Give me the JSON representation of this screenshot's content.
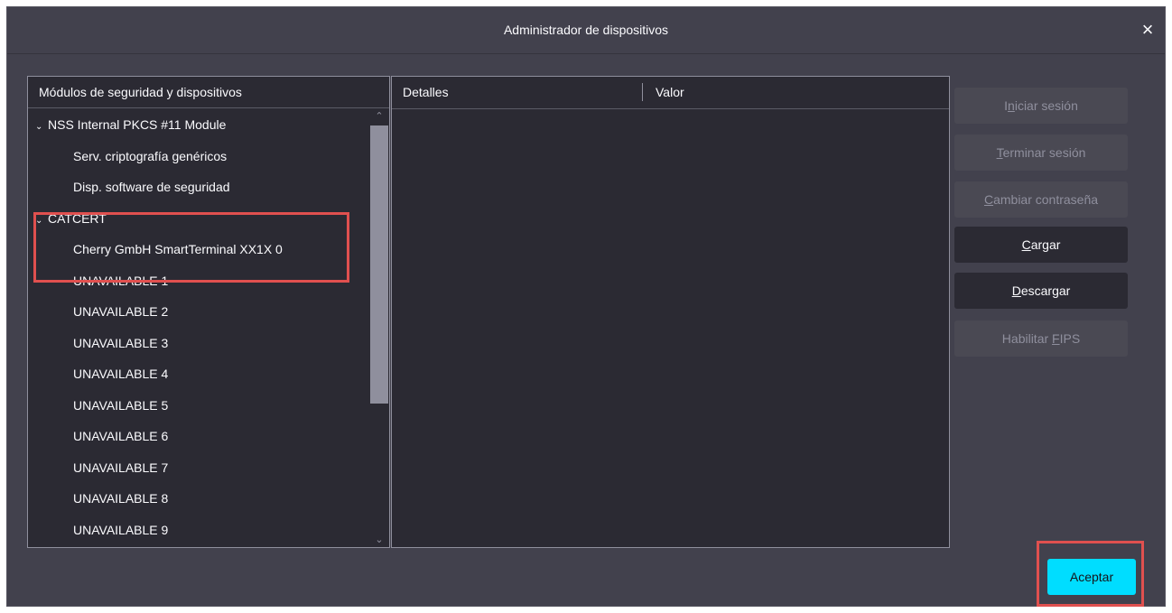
{
  "window": {
    "title": "Administrador de dispositivos",
    "close_icon": "×"
  },
  "tree": {
    "header": "Módulos de seguridad y dispositivos",
    "rows": [
      {
        "label": "NSS Internal PKCS #11 Module",
        "level": 0,
        "expanded": true
      },
      {
        "label": "Serv. criptografía genéricos",
        "level": 1
      },
      {
        "label": "Disp. software de seguridad",
        "level": 1
      },
      {
        "label": "CATCERT",
        "level": 0,
        "expanded": true
      },
      {
        "label": "Cherry GmbH SmartTerminal XX1X 0",
        "level": 1
      },
      {
        "label": "UNAVAILABLE 1",
        "level": 1
      },
      {
        "label": "UNAVAILABLE 2",
        "level": 1
      },
      {
        "label": "UNAVAILABLE 3",
        "level": 1
      },
      {
        "label": "UNAVAILABLE 4",
        "level": 1
      },
      {
        "label": "UNAVAILABLE 5",
        "level": 1
      },
      {
        "label": "UNAVAILABLE 6",
        "level": 1
      },
      {
        "label": "UNAVAILABLE 7",
        "level": 1
      },
      {
        "label": "UNAVAILABLE 8",
        "level": 1
      },
      {
        "label": "UNAVAILABLE 9",
        "level": 1
      }
    ]
  },
  "details": {
    "col_details": "Detalles",
    "col_value": "Valor"
  },
  "buttons": {
    "login": {
      "pre": "I",
      "key": "n",
      "post": "iciar sesión"
    },
    "logout": {
      "pre": "",
      "key": "T",
      "post": "erminar sesión"
    },
    "change_password": {
      "pre": "",
      "key": "C",
      "post": "ambiar contraseña"
    },
    "load": {
      "pre": "",
      "key": "C",
      "post": "argar"
    },
    "unload": {
      "pre": "",
      "key": "D",
      "post": "escargar"
    },
    "enable_fips": {
      "pre": "Habilitar ",
      "key": "F",
      "post": "IPS"
    },
    "accept": "Aceptar"
  },
  "colors": {
    "accent": "#00ddff",
    "highlight": "#e0504f"
  }
}
